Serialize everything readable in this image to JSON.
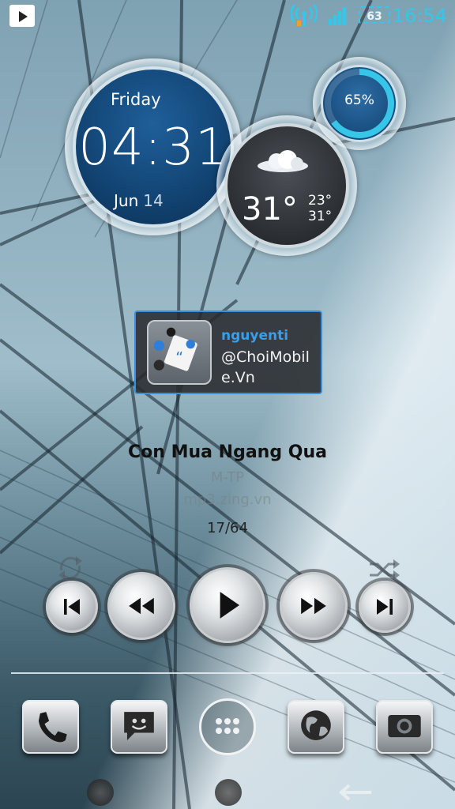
{
  "status_bar": {
    "time": "16:54",
    "battery_text": "63",
    "icons": [
      "play-store-icon",
      "wifi-hotspot-icon",
      "signal-icon",
      "battery-icon"
    ]
  },
  "clock": {
    "day": "Friday",
    "time": "04:31",
    "month": "Jun",
    "date": "14"
  },
  "weather": {
    "temperature": "31°",
    "high": "23°",
    "low": "31°",
    "condition_icon": "cloud-icon"
  },
  "battery_widget": {
    "percent_label": "65%",
    "level": 0.65
  },
  "chat_widget": {
    "user": "nguyenti",
    "message": "@ChoiMobile.Vn"
  },
  "music": {
    "title": "Con Mua Ngang Qua",
    "artist": "M-TP",
    "source": "mp3.zing.vn",
    "track": "17/64"
  },
  "dock": {
    "apps": [
      "phone-icon",
      "messaging-icon",
      "app-drawer-icon",
      "browser-icon",
      "camera-icon"
    ]
  },
  "colors": {
    "accent": "#35c6e8",
    "clock_face": "#134676",
    "chat_user": "#3a9ee8"
  }
}
